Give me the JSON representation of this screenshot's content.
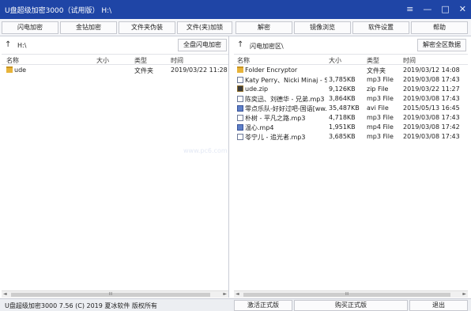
{
  "window": {
    "title": "U盘超级加密3000（试用版） H:\\",
    "controls": [
      "≡",
      "—",
      "□",
      "✕"
    ]
  },
  "toolbar": {
    "buttons": [
      "闪电加密",
      "金钻加密",
      "文件夹伪装",
      "文件(夹)加锁",
      "解密",
      "镜像浏览",
      "软件设置",
      "帮助"
    ]
  },
  "left_pane": {
    "path": "H:\\",
    "action_button": "全盘闪电加密",
    "headers": [
      "名称",
      "大小",
      "类型",
      "时间"
    ],
    "rows": [
      {
        "name": "ude",
        "size": "",
        "type": "文件夹",
        "time": "2019/03/22 11:28",
        "icon": "folder-icon"
      }
    ]
  },
  "right_pane": {
    "path": "闪电加密区\\",
    "action_button": "解密全区数据",
    "headers": [
      "名称",
      "大小",
      "类型",
      "时间"
    ],
    "rows": [
      {
        "name": "Folder Encryptor",
        "size": "",
        "type": "文件夹",
        "time": "2019/03/12 14:08",
        "icon": "folder-icon"
      },
      {
        "name": "Katy Perry、Nicki Minaj - S...",
        "size": "3,785KB",
        "type": "mp3 File",
        "time": "2019/03/08 17:43",
        "icon": "audio-file-icon"
      },
      {
        "name": "ude.zip",
        "size": "9,126KB",
        "type": "zip File",
        "time": "2019/03/22 11:27",
        "icon": "zip-file-icon"
      },
      {
        "name": "陈奕迅、刘德华 - 兄弟.mp3",
        "size": "3,864KB",
        "type": "mp3 File",
        "time": "2019/03/08 17:43",
        "icon": "audio-file-icon"
      },
      {
        "name": "零点乐队-好好过吧-国语[ww...",
        "size": "35,487KB",
        "type": "avi File",
        "time": "2015/05/13 16:45",
        "icon": "video-file-icon"
      },
      {
        "name": "朴树 - 平凡之路.mp3",
        "size": "4,718KB",
        "type": "mp3 File",
        "time": "2019/03/08 17:43",
        "icon": "audio-file-icon"
      },
      {
        "name": "温心.mp4",
        "size": "1,951KB",
        "type": "mp4 File",
        "time": "2019/03/08 17:42",
        "icon": "video-file-icon"
      },
      {
        "name": "苓宁儿 - 追光者.mp3",
        "size": "3,685KB",
        "type": "mp3 File",
        "time": "2019/03/08 17:43",
        "icon": "audio-file-icon"
      }
    ]
  },
  "scrollbar_grip": "III",
  "watermark": "www.pc6.com",
  "status": {
    "text": "U盘超级加密3000 7.56 (C) 2019 夏冰软件 版权所有",
    "buttons": [
      "激活正式版",
      "购买正式版",
      "退出"
    ]
  },
  "colors": {
    "titlebar": "#1f45a6",
    "folder": "#e8b43a"
  }
}
